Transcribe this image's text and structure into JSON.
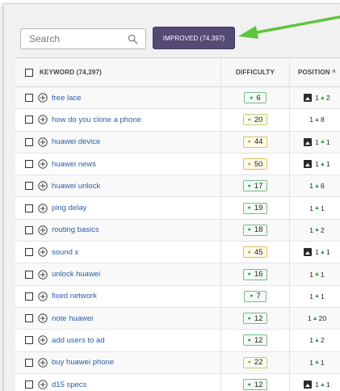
{
  "search": {
    "placeholder": "Search"
  },
  "filter": {
    "improved_label": "IMPROVED (74,397)"
  },
  "colors": {
    "accent": "#544a74",
    "arrow": "#5ec43a",
    "link": "#2a5da6",
    "up": "#2e9a4a"
  },
  "table": {
    "headers": {
      "keyword": "KEYWORD (74,397)",
      "difficulty": "DIFFICULTY",
      "position": "POSITION ^"
    },
    "rows": [
      {
        "keyword": "free lace",
        "difficulty": "6",
        "diff_level": "green",
        "has_feature": true,
        "pos_from": "1",
        "pos_change": "2"
      },
      {
        "keyword": "how do you clone a phone",
        "difficulty": "20",
        "diff_level": "lime",
        "has_feature": false,
        "pos_from": "1",
        "pos_change": "8"
      },
      {
        "keyword": "huawei device",
        "difficulty": "44",
        "diff_level": "yellow",
        "has_feature": true,
        "pos_from": "1",
        "pos_change": "1"
      },
      {
        "keyword": "huawei news",
        "difficulty": "50",
        "diff_level": "yellow",
        "has_feature": true,
        "pos_from": "1",
        "pos_change": "1"
      },
      {
        "keyword": "huawei unlock",
        "difficulty": "17",
        "diff_level": "green",
        "has_feature": false,
        "pos_from": "1",
        "pos_change": "6"
      },
      {
        "keyword": "ping delay",
        "difficulty": "19",
        "diff_level": "green",
        "has_feature": false,
        "pos_from": "1",
        "pos_change": "1"
      },
      {
        "keyword": "routing basics",
        "difficulty": "18",
        "diff_level": "green",
        "has_feature": false,
        "pos_from": "1",
        "pos_change": "2"
      },
      {
        "keyword": "sound x",
        "difficulty": "45",
        "diff_level": "yellow",
        "has_feature": true,
        "pos_from": "1",
        "pos_change": "1"
      },
      {
        "keyword": "unlock huawei",
        "difficulty": "16",
        "diff_level": "green",
        "has_feature": false,
        "pos_from": "1",
        "pos_change": "1"
      },
      {
        "keyword": "fixed network",
        "difficulty": "7",
        "diff_level": "green",
        "has_feature": false,
        "pos_from": "1",
        "pos_change": "1"
      },
      {
        "keyword": "note huawei",
        "difficulty": "12",
        "diff_level": "green",
        "has_feature": false,
        "pos_from": "1",
        "pos_change": "20"
      },
      {
        "keyword": "add users to ad",
        "difficulty": "12",
        "diff_level": "green",
        "has_feature": false,
        "pos_from": "1",
        "pos_change": "2"
      },
      {
        "keyword": "buy huawei phone",
        "difficulty": "22",
        "diff_level": "lime",
        "has_feature": false,
        "pos_from": "1",
        "pos_change": "1"
      },
      {
        "keyword": "d15 specs",
        "difficulty": "12",
        "diff_level": "green",
        "has_feature": true,
        "pos_from": "1",
        "pos_change": "1"
      }
    ]
  }
}
